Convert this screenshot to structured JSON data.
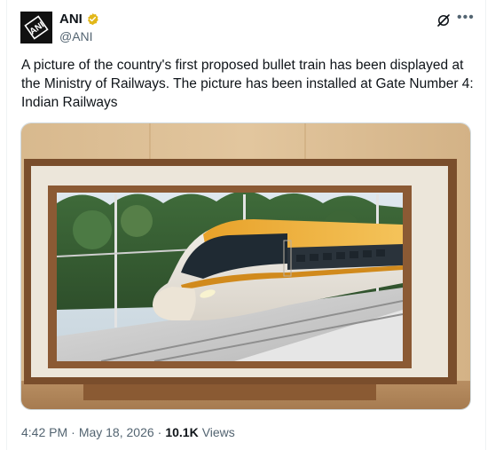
{
  "author": {
    "name": "ANI",
    "handle": "@ANI",
    "avatar_text": "ANI"
  },
  "tweet": {
    "text": "A picture of the country's first proposed bullet train has been displayed at the Ministry of Railways. The picture has been installed at Gate Number 4: Indian Railways"
  },
  "meta": {
    "time": "4:42 PM",
    "separator": "·",
    "date": "May 18, 2026",
    "separator2": "·",
    "views_count": "10.1K",
    "views_label": "Views"
  },
  "icons": {
    "verified": "verified-badge-icon",
    "grok": "grok-icon",
    "more": "more-options-icon"
  },
  "colors": {
    "verified_gold": "#e2b719",
    "secondary_text": "#536471",
    "train_orange": "#f0a82a"
  }
}
